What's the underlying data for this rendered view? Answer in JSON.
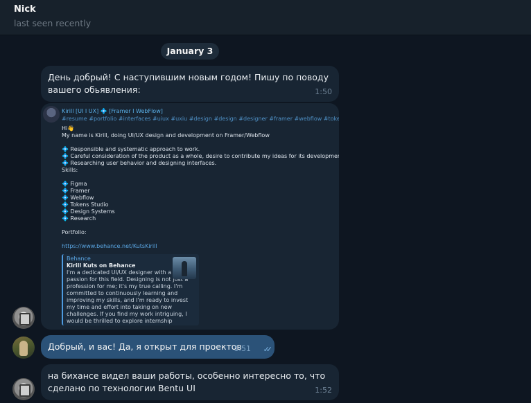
{
  "header": {
    "name": "Nick",
    "status": "last seen recently"
  },
  "date_separator": "January 3",
  "messages": [
    {
      "text": "День добрый! С наступившим новым годом! Пишу по поводу вашего обьявления:",
      "time": "1:50"
    },
    {
      "screenshot": {
        "author": "Kirill [UI I UX] 💠 [Framer I WebFlow]",
        "tags": "#resume #portfolio #interfaces #uiux #uxiu #design #design #designer #framer #webflow #tokens",
        "lines": [
          "Hi👋",
          "My name is Kirill, doing UI/UX design and development on Framer/Webflow",
          "",
          "💠 Responsible and systematic approach to work.",
          "💠 Careful consideration of the product as a whole, desire to contribute my ideas for its development.",
          "💠 Researching user behavior and designing interfaces.",
          "Skills:",
          "",
          "💠 Figma",
          "💠 Framer",
          "💠 Webflow",
          "💠 Tokens Studio",
          "💠 Design Systems",
          "💠 Research",
          "",
          "Portfolio:",
          "",
          "https://www.behance.net/KutsKirill"
        ],
        "preview": {
          "site": "Behance",
          "title": "Kirill Kuts on Behance",
          "text": "I'm a dedicated UI/UX designer with a strong passion for this field. Designing is not just a profession for me; it's my true calling. I'm committed to continuously learning and improving my skills, and I'm ready to invest my time and effort into taking on new challenges. If you find my work intriguing, I would be thrilled to explore internship opportunities or..."
        }
      }
    },
    {
      "text": "Добрый, и вас! Да, я открыт для проектов",
      "time": "1:51",
      "status_icon": "double-check-icon"
    },
    {
      "text": "на бихансе видел ваши работы, особенно интересно то, что сделано по технологии Bentu UI",
      "time": "1:52"
    }
  ],
  "colors": {
    "background": "#0e1621",
    "incoming_bubble": "#182533",
    "outgoing_bubble": "#2b5278",
    "link": "#5aa6e3"
  }
}
